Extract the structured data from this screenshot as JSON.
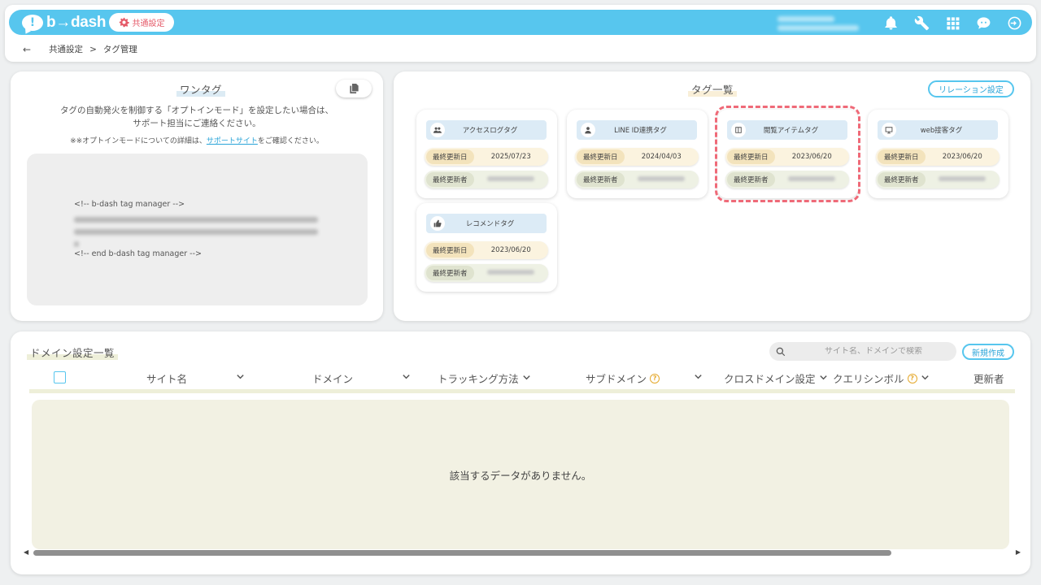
{
  "header": {
    "logo_text": "b→dash",
    "settings_badge": "共通設定",
    "icons": [
      "bell-icon",
      "wrench-icon",
      "grid-icon",
      "chat-icon",
      "logout-icon"
    ]
  },
  "breadcrumb": {
    "parent": "共通設定",
    "separator": ">",
    "current": "タグ管理"
  },
  "onetag": {
    "title": "ワンタグ",
    "desc_line1": "タグの自動発火を制御する「オプトインモード」を設定したい場合は、",
    "desc_line2": "サポート担当にご連絡ください。",
    "note_prefix": "※※オプトインモードについての詳細は、",
    "note_link": "サポートサイト",
    "note_suffix": "をご確認ください。",
    "code_start": "<!-- b-dash tag manager -->",
    "code_end": "<!-- end b-dash tag manager -->"
  },
  "taglist": {
    "title": "タグ一覧",
    "relation_button": "リレーション設定",
    "date_label": "最終更新日",
    "user_label": "最終更新者",
    "tags": [
      {
        "name": "アクセスログタグ",
        "icon": "people-icon",
        "date": "2025/07/23"
      },
      {
        "name": "LINE ID連携タグ",
        "icon": "person-icon",
        "date": "2024/04/03"
      },
      {
        "name": "閲覧アイテムタグ",
        "icon": "item-icon",
        "date": "2023/06/20"
      },
      {
        "name": "web接客タグ",
        "icon": "monitor-icon",
        "date": "2023/06/20"
      },
      {
        "name": "レコメンドタグ",
        "icon": "thumbs-up-icon",
        "date": "2023/06/20"
      }
    ]
  },
  "domain": {
    "title": "ドメイン設定一覧",
    "search_placeholder": "サイト名、ドメインで検索",
    "new_button": "新規作成",
    "columns": {
      "site": "サイト名",
      "domain": "ドメイン",
      "tracking": "トラッキング方法",
      "subdomain": "サブドメイン",
      "crossdomain": "クロスドメイン設定",
      "querysymbol": "クエリシンボル",
      "updater": "更新者"
    },
    "empty_message": "該当するデータがありません。"
  },
  "colors": {
    "accent": "#57c6ee",
    "highlight": "#ef6a78",
    "help": "#e5a92c"
  }
}
